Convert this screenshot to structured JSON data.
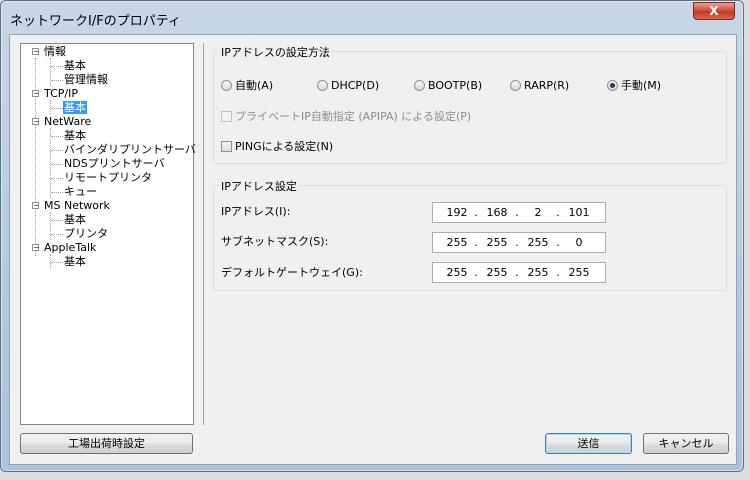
{
  "window": {
    "title": "ネットワークI/Fのプロパティ",
    "close_label": "X"
  },
  "tree": [
    {
      "label": "情報",
      "expander": "−"
    },
    {
      "label": "基本"
    },
    {
      "label": "管理情報"
    },
    {
      "label": "TCP/IP",
      "expander": "−"
    },
    {
      "label": "基本",
      "selected": true
    },
    {
      "label": "NetWare",
      "expander": "−"
    },
    {
      "label": "基本"
    },
    {
      "label": "バインダリプリントサーバ"
    },
    {
      "label": "NDSプリントサーバ"
    },
    {
      "label": "リモートプリンタ"
    },
    {
      "label": "キュー"
    },
    {
      "label": "MS Network",
      "expander": "−"
    },
    {
      "label": "基本"
    },
    {
      "label": "プリンタ"
    },
    {
      "label": "AppleTalk",
      "expander": "−"
    },
    {
      "label": "基本"
    }
  ],
  "method_group": {
    "title": "IPアドレスの設定方法",
    "options": [
      {
        "label": "自動(A)",
        "selected": false
      },
      {
        "label": "DHCP(D)",
        "selected": false
      },
      {
        "label": "BOOTP(B)",
        "selected": false
      },
      {
        "label": "RARP(R)",
        "selected": false
      },
      {
        "label": "手動(M)",
        "selected": true
      }
    ],
    "apipa_label": "プライベートIP自動指定 (APIPA) による設定(P)",
    "ping_label": "PINGによる設定(N)"
  },
  "address_group": {
    "title": "IPアドレス設定",
    "ip_label": "IPアドレス(I):",
    "ip": [
      "192",
      "168",
      "2",
      "101"
    ],
    "subnet_label": "サブネットマスク(S):",
    "subnet": [
      "255",
      "255",
      "255",
      "0"
    ],
    "gateway_label": "デフォルトゲートウェイ(G):",
    "gateway": [
      "255",
      "255",
      "255",
      "255"
    ],
    "separator": "."
  },
  "buttons": {
    "factory_reset": "工場出荷時設定",
    "send": "送信",
    "cancel": "キャンセル"
  }
}
